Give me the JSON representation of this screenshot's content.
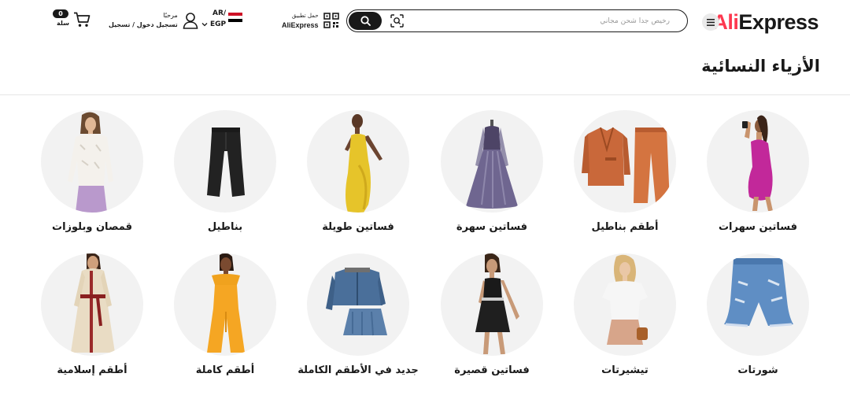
{
  "header": {
    "logo": {
      "star_part": "Ali",
      "rest": "Express"
    },
    "menu_icon": "hamburger-menu-icon",
    "search": {
      "placeholder": "رخيص جدا شحن مجاني",
      "value": "",
      "camera_icon": "image-search-icon",
      "button_icon": "search-icon"
    },
    "app": {
      "line1": "حمل تطبيق",
      "line2": "AliExpress",
      "icon": "qr-code-icon"
    },
    "locale": {
      "language": "AR/",
      "currency": "EGP",
      "flag": "egypt-flag-icon"
    },
    "account": {
      "greeting": "مرحبًا",
      "action": "تسجيل دخول / تسجيل",
      "icon": "user-icon"
    },
    "cart": {
      "count": "0",
      "label": "سلة",
      "icon": "cart-icon"
    }
  },
  "page": {
    "title": "الأزياء النسائية"
  },
  "categories": [
    {
      "label": "فساتين سهرات",
      "icon": "magenta-bodycon-dress-image"
    },
    {
      "label": "أطقم بناطيل",
      "icon": "orange-blazer-pants-set-image"
    },
    {
      "label": "فساتين سهرة",
      "icon": "purple-evening-gown-image"
    },
    {
      "label": "فساتين طويلة",
      "icon": "yellow-maxi-dress-image"
    },
    {
      "label": "بناطيل",
      "icon": "black-flare-pants-image"
    },
    {
      "label": "قمصان وبلوزات",
      "icon": "white-lace-blouse-image"
    },
    {
      "label": "شورتات",
      "icon": "denim-shorts-image"
    },
    {
      "label": "تيشيرتات",
      "icon": "white-tshirt-image"
    },
    {
      "label": "فساتين قصيرة",
      "icon": "black-mini-dress-image"
    },
    {
      "label": "جديد في الأطقم الكاملة",
      "icon": "denim-jacket-skirt-set-image"
    },
    {
      "label": "أطقم كاملة",
      "icon": "orange-jumpsuit-image"
    },
    {
      "label": "أطقم إسلامية",
      "icon": "abaya-image"
    }
  ],
  "colors": {
    "accent_star": "#fd384f",
    "text": "#191919",
    "circle_bg": "#f2f2f2",
    "divider": "#e6e6e6"
  }
}
